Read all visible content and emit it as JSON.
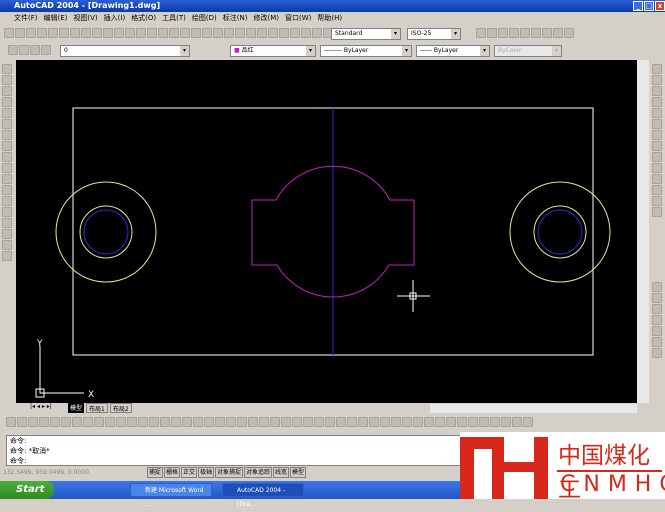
{
  "window": {
    "title": "AutoCAD 2004 - [Drawing1.dwg]"
  },
  "menu": [
    "文件(F)",
    "编辑(E)",
    "视图(V)",
    "插入(I)",
    "格式(O)",
    "工具(T)",
    "绘图(D)",
    "标注(N)",
    "修改(M)",
    "窗口(W)",
    "帮助(H)"
  ],
  "toolbar": {
    "text_style": "Standard",
    "dim_style": "ISO-25",
    "layer": "0",
    "color": "品红",
    "linetype": "ByLayer",
    "lineweight": "ByLayer",
    "plotstyle": "ByColor"
  },
  "tabs": [
    "模型",
    "布局1",
    "布局2"
  ],
  "command": {
    "lines": [
      "命令:",
      "命令:  *取消*",
      "命令:"
    ]
  },
  "status": {
    "coords": "132.5499, 959.0499, 0.0000",
    "buttons": [
      "捕捉",
      "栅格",
      "正交",
      "极轴",
      "对象捕捉",
      "对象追踪",
      "线宽",
      "模型"
    ]
  },
  "ucs": {
    "x": "X",
    "y": "Y"
  },
  "taskbar": {
    "start": "Start",
    "tasks": [
      "新建 Microsoft Word ...",
      "AutoCAD 2004 - [Dra..."
    ]
  },
  "watermark": {
    "cn": "中国煤化工",
    "en": "CNMHG"
  },
  "colors": {
    "magenta": "#c020c0",
    "yellow": "#e8e890",
    "blue": "#2030d0",
    "white": "#ffffff"
  }
}
